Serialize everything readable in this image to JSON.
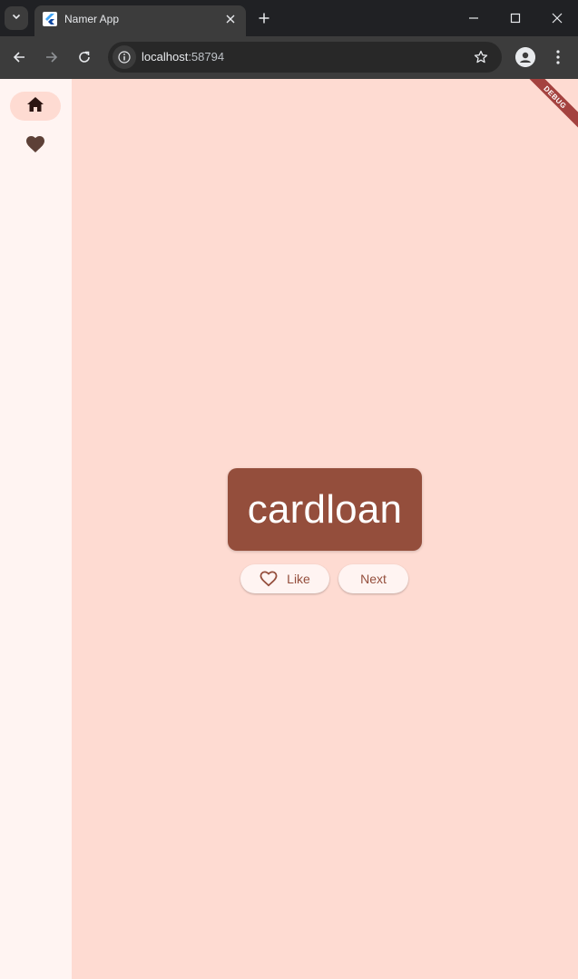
{
  "browser": {
    "tab_title": "Namer App",
    "url_host": "localhost",
    "url_port": ":58794"
  },
  "app": {
    "nav": [
      {
        "icon": "home-icon",
        "selected": true
      },
      {
        "icon": "heart-icon",
        "selected": false
      }
    ],
    "word_pair": "cardloan",
    "like_label": "Like",
    "next_label": "Next",
    "debug_banner": "DEBUG"
  },
  "colors": {
    "background": "#fedbd2",
    "rail": "#fff4f2",
    "card": "#944e3c",
    "card_text": "#ffffff",
    "button_text": "#944e3c"
  }
}
